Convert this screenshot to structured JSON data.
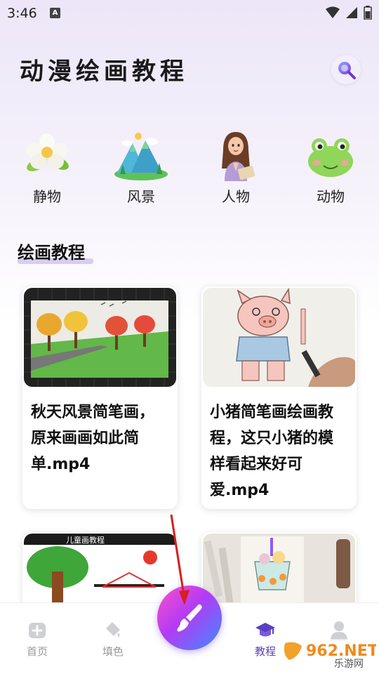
{
  "status_bar": {
    "time": "3:46",
    "notification": "A"
  },
  "header": {
    "title": "动漫绘画教程"
  },
  "categories": [
    {
      "label": "静物",
      "icon": "flower-icon"
    },
    {
      "label": "风景",
      "icon": "mountain-icon"
    },
    {
      "label": "人物",
      "icon": "person-icon"
    },
    {
      "label": "动物",
      "icon": "frog-icon"
    }
  ],
  "section": {
    "title": "绘画教程"
  },
  "cards": [
    {
      "title_lines": [
        "秋天风景简笔画，",
        "原来画画如此简",
        "单.mp4"
      ]
    },
    {
      "title_lines": [
        "小猪简笔画绘画教",
        "程，这只小猪的模",
        "样看起来好可",
        "爱.mp4"
      ]
    },
    {
      "title_lines": []
    },
    {
      "title_lines": []
    }
  ],
  "thumbnail_text": {
    "card3_header": "儿童画教程"
  },
  "nav": {
    "items": [
      {
        "label": "首页",
        "icon": "home-icon"
      },
      {
        "label": "填色",
        "icon": "paint-bucket-icon"
      },
      {
        "label": "",
        "icon": "brush-icon"
      },
      {
        "label": "教程",
        "icon": "graduation-cap-icon",
        "active": true
      },
      {
        "label": "",
        "icon": "user-icon"
      }
    ]
  },
  "watermark": {
    "brand": "962.NET",
    "sub": "乐游网"
  },
  "colors": {
    "accent": "#5b3fc4",
    "nav_inactive": "#999999"
  }
}
